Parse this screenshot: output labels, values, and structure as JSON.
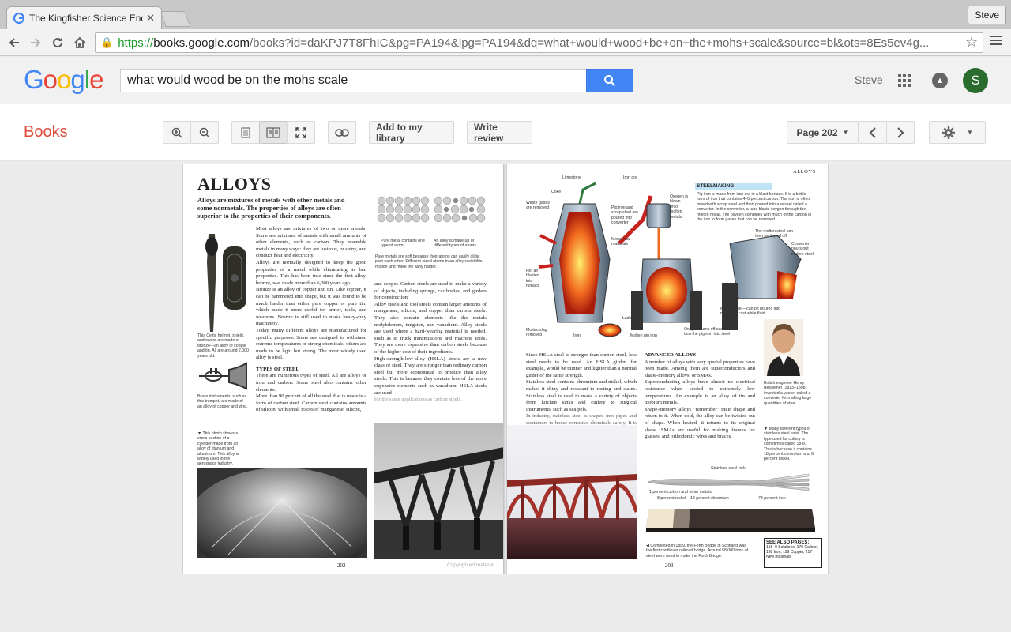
{
  "browser": {
    "tab_title": "The Kingfisher Science Enc",
    "profile": "Steve",
    "url_scheme": "https://",
    "url_host": "books.google.com",
    "url_rest": "/books?id=daKPJ7T8FhIC&pg=PA194&lpg=PA194&dq=what+would+wood+be+on+the+mohs+scale&source=bl&ots=8Es5ev4g..."
  },
  "google": {
    "search_query": "what would wood be on the mohs scale",
    "user_name": "Steve",
    "avatar_letter": "S"
  },
  "books_bar": {
    "title": "Books",
    "add_to_library": "Add to my library",
    "write_review": "Write review",
    "page_select": "Page 202"
  },
  "book": {
    "left": {
      "heading": "ALLOYS",
      "intro": "Alloys are mixtures of metals with other metals and some nonmetals. The properties of alloys are often superior to the properties of their components.",
      "col1_p1": "Most alloys are mixtures of two or more metals. Some are mixtures of metals with small amounts of other elements, such as carbon. They resemble metals in many ways: they are lustrous, or shiny, and conduct heat and electricity.",
      "col1_p2": "Alloys are normally designed to keep the good properties of a metal while eliminating its bad properties. This has been true since the first alloy, bronze, was made more than 6,000 years ago.",
      "col1_p3": "Bronze is an alloy of copper and tin. Like copper, it can be hammered into shape, but it was found to be much harder than either pure copper or pure tin, which made it more useful for armor, tools, and weapons. Bronze is still used to make heavy-duty machinery.",
      "col1_p4": "Today, many different alloys are manufactured for specific purposes. Some are designed to withstand extreme temperatures or strong chemicals; others are made to be light but strong. The most widely used alloy is steel.",
      "col1_sub": "TYPES OF STEEL",
      "col1_p5": "There are numerous types of steel. All are alloys of iron and carbon. Some steel also contains other elements.",
      "col1_p6": "More than 90 percent of all the steel that is made is a form of carbon steel. Carbon steel contains amounts of silicon, with small traces of manganese, silicon,",
      "col2_p1": "and copper. Carbon steels are used to make a variety of objects, including springs, car bodies, and girders for construction.",
      "col2_p2": "Alloy steels and tool steels contain larger amounts of manganese, silicon, and copper than carbon steels. They also contain elements like the metals molybdenum, tungsten, and vanadium. Alloy steels are used where a hard-wearing material is needed, such as in truck transmissions and machine tools. They are more expensive than carbon steels because of the higher cost of their ingredients.",
      "col2_p3": "High-strength-low-alloy (HSLA) steels are a new class of steel. They are stronger than ordinary carbon steel but more economical to produce than alloy steels. This is because they contain less of the more expensive elements such as vanadium. HSLA steels are used",
      "col2_p3b": "for the same applications as carbon steels.",
      "cap_helmet": "This Celtic helmet, shield, and sword are made of bronze—an alloy of copper and tin. All are around 2,000 years old.",
      "cap_trumpet": "Brass instruments, such as this trumpet, are made of an alloy of copper and zinc.",
      "cap_cylinder": "▼ This photo shows a cross section of a cylinder made from an alloy of titanium and aluminum. This alloy is widely used in the aerospace industry.",
      "cap_pure": "Pure metal contains one type of atom",
      "cap_alloy": "An alloy is made up of different types of atoms",
      "cap_soft": "Pure metals are soft because their atoms can easily glide past each other. Different-sized atoms in an alloy resist this motion and make the alloy harder.",
      "page_num": "202",
      "copyright": "Copyrighted material"
    },
    "right": {
      "runhead": "ALLOYS",
      "steel_head": "STEELMAKING",
      "steel_text": "Pig iron is made from iron ore in a blast furnace. It is a brittle form of iron that contains 4–5 percent carbon. The iron is often mixed with scrap steel and then poured into a vessel called a converter. In the converter, a tube blasts oxygen through the molten metal. The oxygen combines with much of the carbon in the iron to form gases that can be removed.",
      "lbl_limestone": "Limestone",
      "lbl_ironore": "Iron ore",
      "lbl_coke": "Coke",
      "lbl_waste": "Waste gases are removed",
      "lbl_hotair": "Hot air blasted into furnace",
      "lbl_slag": "Molten slag removed",
      "lbl_iron": "Iron",
      "lbl_ladle": "Ladle",
      "lbl_moltenpig": "Molten pig iron",
      "lbl_oxygen_blown": "Oxygen is blown onto molten metals",
      "lbl_pigscrap": "Pig iron and scrap steel are poured into converter",
      "lbl_mixed": "Mixed raw materials",
      "lbl_oxygen_burns": "Oxygen burns off carbon to turn the pig iron into steel",
      "lbl_tipped": "The molten steel can then be tipped off.",
      "lbl_converter": "Converter pours out molten steel",
      "lbl_molds": "Molten steel—can be poured into molds, or cast while fluid",
      "col1_p1": "Since HSLA steel is stronger than carbon steel, less steel needs to be used. An HSLA girder, for example, would be thinner and lighter than a normal girder of the same strength.",
      "col1_p2": "Stainless steel contains chromium and nickel, which makes it shiny and resistant to rusting and stains. Stainless steel is used to make a variety of objects from kitchen sinks and cutlery to surgical instruments, such as scalpels.",
      "col1_p3": "In industry, stainless steel is shaped into pipes and containers to house corrosive chemicals safely. It is also used to make ball bearings.",
      "col2_sub": "ADVANCED ALLOYS",
      "col2_p1": "A number of alloys with very special properties have been made. Among them are superconductors and shape-memory alloys, or SMAs.",
      "col2_p2": "Superconducting alloys have almost no electrical resistance when cooled to extremely low temperatures. An example is an alloy of tin and niobium metals.",
      "col2_p3": "Shape-memory alloys \"remember\" their shape and return to it. When cold, the alloy can be twisted out of shape. When heated, it returns to its original shape. SMAs are useful for making frames for glasses, and orthodontic wires and braces.",
      "cap_bessemer": "British engineer Henry Bessemer (1813–1898) invented a vessel called a converter for making large quantities of steel.",
      "cap_types": "▼ Many different types of stainless steel exist. The type used for cutlery is sometimes called 18-8. This is because it contains 18 percent chromium and 8 percent nickel.",
      "cap_fork": "Stainless steel fork",
      "cap_carbon": "1 percent carbon and other metals",
      "cap_nickel": "8 percent nickel",
      "cap_chromium": "18 percent chromium",
      "cap_iron": "73 percent iron",
      "cap_bridge": "◀ Completed in 1889, the Forth Bridge in Scotland was the first cantilever railroad bridge. Around 58,000 tons of steel were used to make the Forth Bridge.",
      "see_also_title": "SEE ALSO PAGES:",
      "see_also_text": "158–9 Solutions, 170 Carbon, 198 Iron, 199 Copper, 217 New materials",
      "page_num": "203"
    }
  }
}
